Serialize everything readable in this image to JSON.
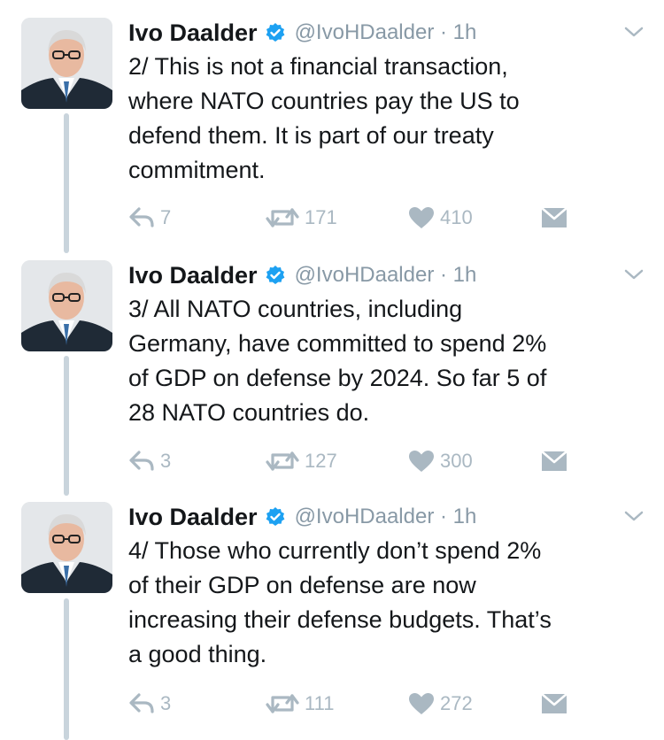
{
  "colors": {
    "accent": "#1da1f2",
    "icon_gray": "#aab8c2",
    "thread_line": "#c9d4dc",
    "text": "#14171a",
    "muted": "#8899a6"
  },
  "tweets": [
    {
      "author": "Ivo Daalder",
      "handle_time": "@IvoHDaalder · 1h",
      "text": "2/ This is not a financial transaction,\nwhere NATO countries pay the US to\ndefend them. It is part of our treaty\ncommitment.",
      "replies": "7",
      "retweets": "171",
      "likes": "410"
    },
    {
      "author": "Ivo Daalder",
      "handle_time": "@IvoHDaalder · 1h",
      "text": "3/ All NATO countries, including\nGermany, have committed to spend 2%\nof GDP on defense by 2024. So far 5 of\n28 NATO countries do.",
      "replies": "3",
      "retweets": "127",
      "likes": "300"
    },
    {
      "author": "Ivo Daalder",
      "handle_time": "@IvoHDaalder · 1h",
      "text": "4/ Those who currently don’t spend 2%\nof their GDP on defense are now\nincreasing their defense budgets. That’s\na good thing.",
      "replies": "3",
      "retweets": "111",
      "likes": "272"
    }
  ],
  "icons": {
    "reply": "reply-icon",
    "retweet": "retweet-icon",
    "like": "heart-icon",
    "dm": "envelope-icon",
    "more": "chevron-down-icon",
    "verified": "verified-badge-icon"
  }
}
